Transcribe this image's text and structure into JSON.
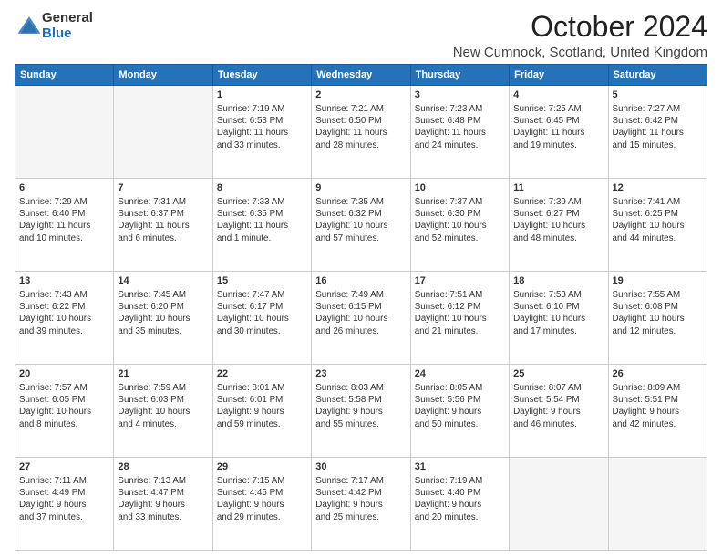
{
  "logo": {
    "general": "General",
    "blue": "Blue"
  },
  "header": {
    "month": "October 2024",
    "location": "New Cumnock, Scotland, United Kingdom"
  },
  "days_of_week": [
    "Sunday",
    "Monday",
    "Tuesday",
    "Wednesday",
    "Thursday",
    "Friday",
    "Saturday"
  ],
  "weeks": [
    [
      {
        "day": "",
        "info": ""
      },
      {
        "day": "",
        "info": ""
      },
      {
        "day": "1",
        "info": "Sunrise: 7:19 AM\nSunset: 6:53 PM\nDaylight: 11 hours\nand 33 minutes."
      },
      {
        "day": "2",
        "info": "Sunrise: 7:21 AM\nSunset: 6:50 PM\nDaylight: 11 hours\nand 28 minutes."
      },
      {
        "day": "3",
        "info": "Sunrise: 7:23 AM\nSunset: 6:48 PM\nDaylight: 11 hours\nand 24 minutes."
      },
      {
        "day": "4",
        "info": "Sunrise: 7:25 AM\nSunset: 6:45 PM\nDaylight: 11 hours\nand 19 minutes."
      },
      {
        "day": "5",
        "info": "Sunrise: 7:27 AM\nSunset: 6:42 PM\nDaylight: 11 hours\nand 15 minutes."
      }
    ],
    [
      {
        "day": "6",
        "info": "Sunrise: 7:29 AM\nSunset: 6:40 PM\nDaylight: 11 hours\nand 10 minutes."
      },
      {
        "day": "7",
        "info": "Sunrise: 7:31 AM\nSunset: 6:37 PM\nDaylight: 11 hours\nand 6 minutes."
      },
      {
        "day": "8",
        "info": "Sunrise: 7:33 AM\nSunset: 6:35 PM\nDaylight: 11 hours\nand 1 minute."
      },
      {
        "day": "9",
        "info": "Sunrise: 7:35 AM\nSunset: 6:32 PM\nDaylight: 10 hours\nand 57 minutes."
      },
      {
        "day": "10",
        "info": "Sunrise: 7:37 AM\nSunset: 6:30 PM\nDaylight: 10 hours\nand 52 minutes."
      },
      {
        "day": "11",
        "info": "Sunrise: 7:39 AM\nSunset: 6:27 PM\nDaylight: 10 hours\nand 48 minutes."
      },
      {
        "day": "12",
        "info": "Sunrise: 7:41 AM\nSunset: 6:25 PM\nDaylight: 10 hours\nand 44 minutes."
      }
    ],
    [
      {
        "day": "13",
        "info": "Sunrise: 7:43 AM\nSunset: 6:22 PM\nDaylight: 10 hours\nand 39 minutes."
      },
      {
        "day": "14",
        "info": "Sunrise: 7:45 AM\nSunset: 6:20 PM\nDaylight: 10 hours\nand 35 minutes."
      },
      {
        "day": "15",
        "info": "Sunrise: 7:47 AM\nSunset: 6:17 PM\nDaylight: 10 hours\nand 30 minutes."
      },
      {
        "day": "16",
        "info": "Sunrise: 7:49 AM\nSunset: 6:15 PM\nDaylight: 10 hours\nand 26 minutes."
      },
      {
        "day": "17",
        "info": "Sunrise: 7:51 AM\nSunset: 6:12 PM\nDaylight: 10 hours\nand 21 minutes."
      },
      {
        "day": "18",
        "info": "Sunrise: 7:53 AM\nSunset: 6:10 PM\nDaylight: 10 hours\nand 17 minutes."
      },
      {
        "day": "19",
        "info": "Sunrise: 7:55 AM\nSunset: 6:08 PM\nDaylight: 10 hours\nand 12 minutes."
      }
    ],
    [
      {
        "day": "20",
        "info": "Sunrise: 7:57 AM\nSunset: 6:05 PM\nDaylight: 10 hours\nand 8 minutes."
      },
      {
        "day": "21",
        "info": "Sunrise: 7:59 AM\nSunset: 6:03 PM\nDaylight: 10 hours\nand 4 minutes."
      },
      {
        "day": "22",
        "info": "Sunrise: 8:01 AM\nSunset: 6:01 PM\nDaylight: 9 hours\nand 59 minutes."
      },
      {
        "day": "23",
        "info": "Sunrise: 8:03 AM\nSunset: 5:58 PM\nDaylight: 9 hours\nand 55 minutes."
      },
      {
        "day": "24",
        "info": "Sunrise: 8:05 AM\nSunset: 5:56 PM\nDaylight: 9 hours\nand 50 minutes."
      },
      {
        "day": "25",
        "info": "Sunrise: 8:07 AM\nSunset: 5:54 PM\nDaylight: 9 hours\nand 46 minutes."
      },
      {
        "day": "26",
        "info": "Sunrise: 8:09 AM\nSunset: 5:51 PM\nDaylight: 9 hours\nand 42 minutes."
      }
    ],
    [
      {
        "day": "27",
        "info": "Sunrise: 7:11 AM\nSunset: 4:49 PM\nDaylight: 9 hours\nand 37 minutes."
      },
      {
        "day": "28",
        "info": "Sunrise: 7:13 AM\nSunset: 4:47 PM\nDaylight: 9 hours\nand 33 minutes."
      },
      {
        "day": "29",
        "info": "Sunrise: 7:15 AM\nSunset: 4:45 PM\nDaylight: 9 hours\nand 29 minutes."
      },
      {
        "day": "30",
        "info": "Sunrise: 7:17 AM\nSunset: 4:42 PM\nDaylight: 9 hours\nand 25 minutes."
      },
      {
        "day": "31",
        "info": "Sunrise: 7:19 AM\nSunset: 4:40 PM\nDaylight: 9 hours\nand 20 minutes."
      },
      {
        "day": "",
        "info": ""
      },
      {
        "day": "",
        "info": ""
      }
    ]
  ]
}
